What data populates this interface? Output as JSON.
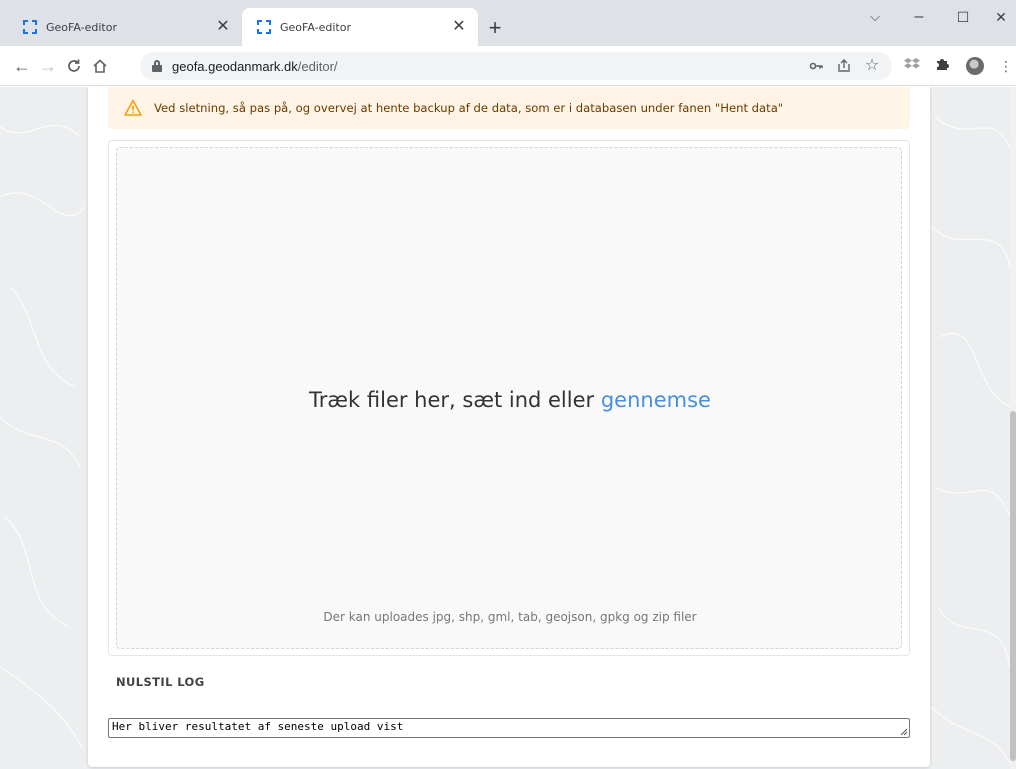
{
  "browser": {
    "tabs": [
      {
        "title": "GeoFA-editor",
        "active": false
      },
      {
        "title": "GeoFA-editor",
        "active": true
      }
    ],
    "new_tab_symbol": "+",
    "window_controls": {
      "chevron": "⌵",
      "minimize": "–",
      "maximize": "☐",
      "close": "✕"
    },
    "url": {
      "host": "geofa.geodanmark.dk",
      "path": "/editor/"
    },
    "icons": {
      "back": "arrow-left-icon",
      "forward": "arrow-right-icon",
      "reload": "reload-icon",
      "home": "home-icon",
      "lock": "lock-icon",
      "key": "key-icon",
      "share": "share-icon",
      "bookmark": "star-icon",
      "extension_1": "dropbox-icon",
      "extensions": "puzzle-icon",
      "profile": "avatar",
      "menu": "kebab-menu-icon"
    }
  },
  "page": {
    "warning": {
      "text": "Ved sletning, så pas på, og overvej at hente backup af de data, som er i databasen under fanen \"Hent data\"",
      "color": "#663c00",
      "background": "#fff4e5",
      "icon_color": "#f59e0b"
    },
    "dropzone": {
      "label_prefix": "Træk filer her, sæt ind eller ",
      "browse_link": "gennemse",
      "hint": "Der kan uploades jpg, shp, gml, tab, geojson, gpkg og zip filer",
      "link_color": "#4a8fd9"
    },
    "reset_log_button": "NULSTIL LOG",
    "log": {
      "value": "Her bliver resultatet af seneste upload vist"
    }
  }
}
